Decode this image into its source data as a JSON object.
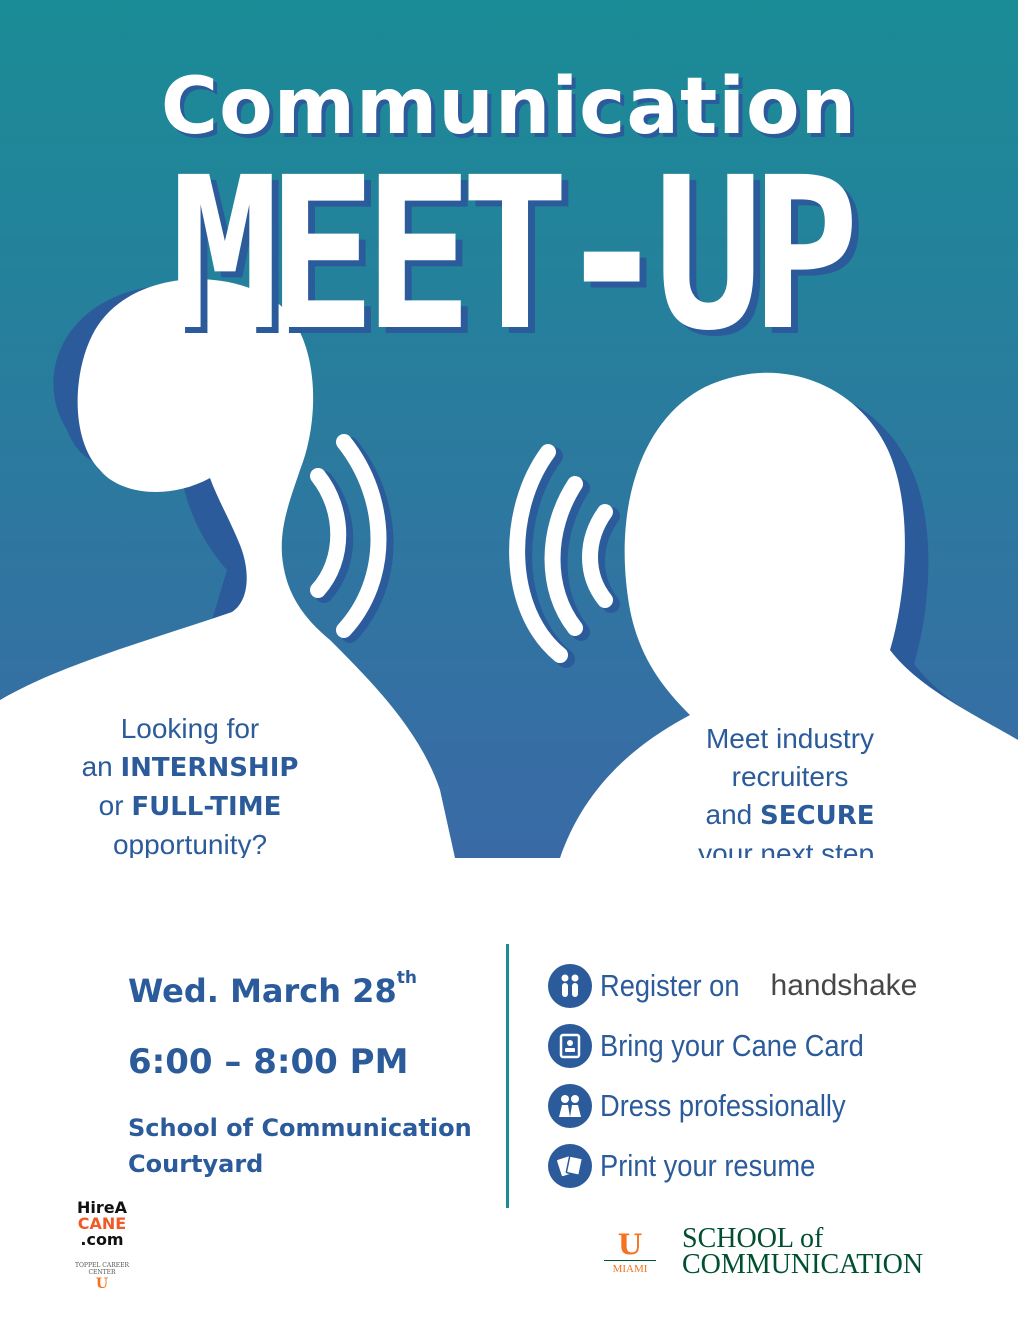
{
  "colors": {
    "bg_top": "#1a8c96",
    "bg_bottom": "#3a6aa6",
    "accent": "#2b5b9a",
    "divider": "#1e8a97",
    "miami_orange": "#f47321",
    "miami_green": "#005030"
  },
  "title": {
    "line1": "Communication",
    "line2": "MEET-UP"
  },
  "left_blurb": {
    "l1": "Looking for",
    "l2a": "an",
    "l2b": "INTERNSHIP",
    "l3a": "or",
    "l3b": "FULL-TIME",
    "l4": "opportunity?"
  },
  "right_blurb": {
    "l1": "Meet industry",
    "l2": "recruiters",
    "l3a": "and",
    "l3b": "SECURE",
    "l4": "your next step."
  },
  "event": {
    "date": "Wed. March 28",
    "date_sup": "th",
    "time": "6:00 – 8:00 PM",
    "loc1": "School of Communication",
    "loc2": "Courtyard"
  },
  "steps": [
    {
      "icon": "handshake-people-icon",
      "text": "Register on",
      "brand": "handshake"
    },
    {
      "icon": "id-card-icon",
      "text": "Bring your Cane Card"
    },
    {
      "icon": "people-icon",
      "text": "Dress professionally"
    },
    {
      "icon": "papers-icon",
      "text": "Print your resume"
    }
  ],
  "logos": {
    "hire": {
      "l1": "HireA",
      "l2": "CANE",
      "l3": ".com",
      "sub": "TOPPEL CAREER CENTER"
    },
    "soc": {
      "u": "U",
      "miami": "MIAMI",
      "name1": "SCHOOL of",
      "name2": "COMMUNICATION"
    }
  }
}
